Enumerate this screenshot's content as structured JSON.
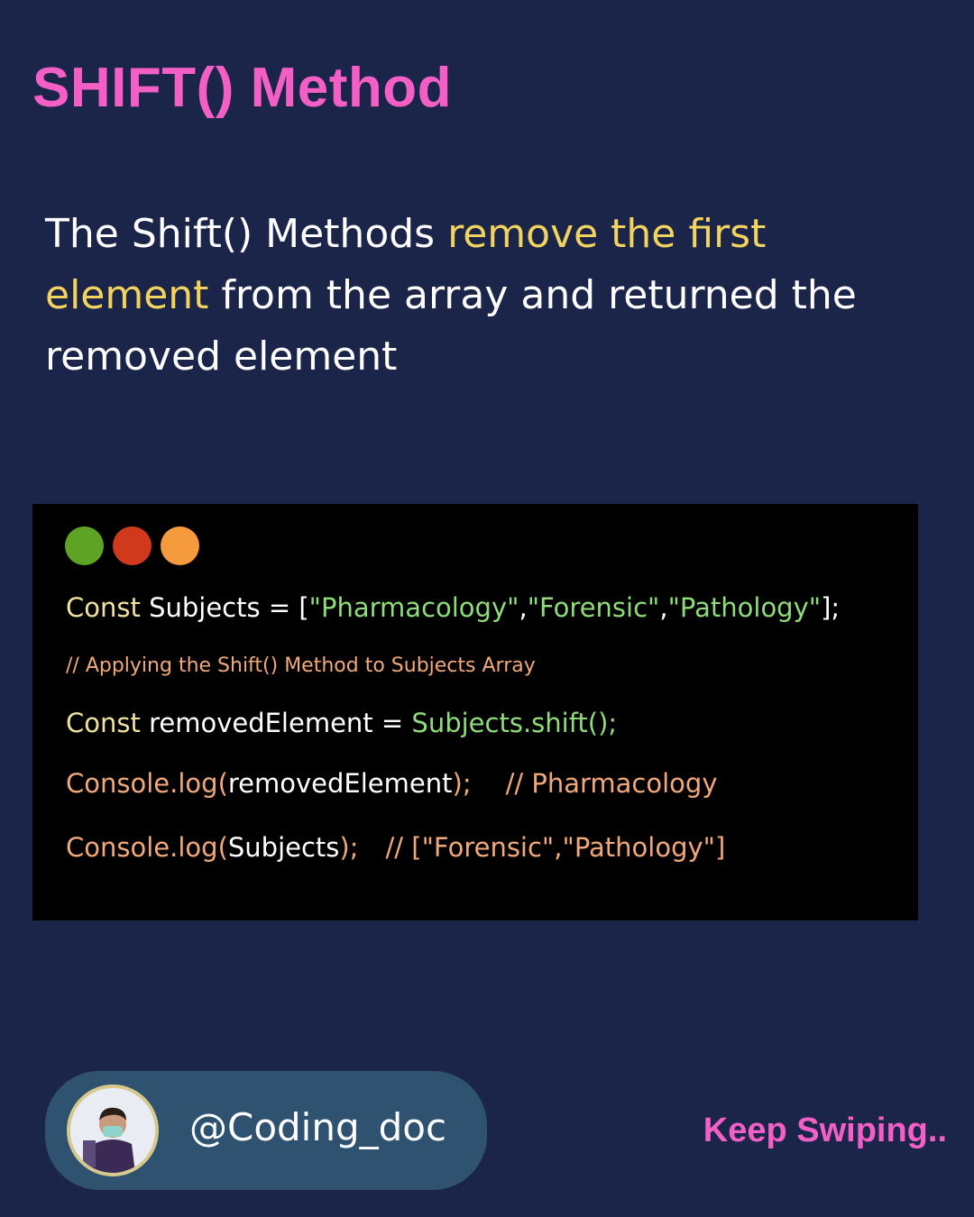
{
  "title": "SHIFT() Method",
  "description": {
    "part1": "The Shift() Methods ",
    "highlight": "remove the first element",
    "part2": " from the array and returned the removed element"
  },
  "code_window": {
    "dots": [
      {
        "name": "green-dot",
        "color": "#5fa324"
      },
      {
        "name": "red-dot",
        "color": "#d0391c"
      },
      {
        "name": "orange-dot",
        "color": "#f59b3e"
      }
    ],
    "line1": {
      "keyword": "Const",
      "text": " Subjects = [",
      "str1": "\"Pharmacology\"",
      "comma1": ",",
      "str2": "\"Forensic\"",
      "comma2": ",",
      "str3": "\"Pathology\"",
      "end": "];"
    },
    "comment_line": "// Applying the Shift() Method to Subjects Array",
    "line3": {
      "keyword": "Const",
      "text": " removedElement = ",
      "call": "Subjects.shift();"
    },
    "line4": {
      "fn": "Console.log",
      "paren_open": "(",
      "arg": "removedElement",
      "end": ");",
      "comment": "// Pharmacology"
    },
    "line5": {
      "fn": "Console.log",
      "paren_open": "(",
      "arg": "Subjects",
      "end": ");",
      "comment": "// [\"Forensic\",\"Pathology\"]"
    }
  },
  "footer": {
    "handle": "@Coding_doc",
    "cta": "Keep Swiping.."
  },
  "colors": {
    "background": "#1b254a",
    "title_pink": "#f35fc4",
    "highlight_yellow": "#f2d35e",
    "pill": "#2e5270"
  }
}
